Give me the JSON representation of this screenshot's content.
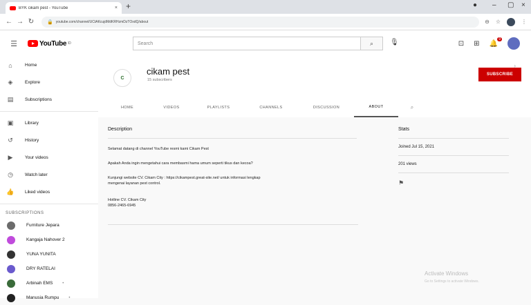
{
  "browser": {
    "tab_title": "BYK cikam pest - YouTube",
    "tab_close": "×",
    "new_tab": "+",
    "url": "youtube.com/channel/UCtAKcujdMdKRHzmDzTOxdQ/about"
  },
  "youtube_header": {
    "logo_text": "YouTube",
    "logo_region": "ID",
    "search_placeholder": "Search",
    "notification_count": "9"
  },
  "sidebar": {
    "main_items": [
      {
        "label": "Home",
        "icon": "home-icon"
      },
      {
        "label": "Explore",
        "icon": "compass-icon"
      },
      {
        "label": "Subscriptions",
        "icon": "subscriptions-icon"
      }
    ],
    "library_items": [
      {
        "label": "Library",
        "icon": "library-icon"
      },
      {
        "label": "History",
        "icon": "history-icon"
      },
      {
        "label": "Your videos",
        "icon": "video-icon"
      },
      {
        "label": "Watch later",
        "icon": "clock-icon"
      },
      {
        "label": "Liked videos",
        "icon": "thumb-up-icon"
      }
    ],
    "subscriptions_heading": "SUBSCRIPTIONS",
    "subscriptions": [
      {
        "label": "Furniture Jepara",
        "color": "#6b6b6b"
      },
      {
        "label": "Kangaja Nahover 2",
        "color": "#c04bdc"
      },
      {
        "label": "YUNA YUNITA",
        "color": "#333333"
      },
      {
        "label": "DRY RATELAI",
        "color": "#6a5acd"
      },
      {
        "label": "Arbinah EMS",
        "color": "#3a6b3a",
        "extra": "•"
      },
      {
        "label": "Manusia Rumpu",
        "color": "#222222",
        "extra": "•"
      }
    ]
  },
  "channel": {
    "avatar_text": "C",
    "name": "cikam pest",
    "subscribers": "15 subscribers",
    "subscribe_label": "SUBSCRIBE",
    "tabs": [
      "HOME",
      "VIDEOS",
      "PLAYLISTS",
      "CHANNELS",
      "DISCUSSION",
      "ABOUT"
    ],
    "active_tab": "ABOUT"
  },
  "about": {
    "description_heading": "Description",
    "description_lines": [
      "Selamat datang di channel YouTube resmi kami Cikam Pest",
      "Apakah Anda ingin mengetahui cara membasmi hama umum seperti tikus dan kecoa?",
      "Kunjungi website CV. Cikam City : https://cikampest.great-site.net/ untuk informasi lengkap",
      "mengenai layanan pest control.",
      "Hotline CV. Cikam City",
      "0856-2465-6945"
    ],
    "stats_heading": "Stats",
    "joined": "Joined Jul 15, 2021",
    "views": "201 views"
  },
  "watermark": {
    "title": "Activate Windows",
    "subtitle": "Go to Settings to activate Windows."
  }
}
